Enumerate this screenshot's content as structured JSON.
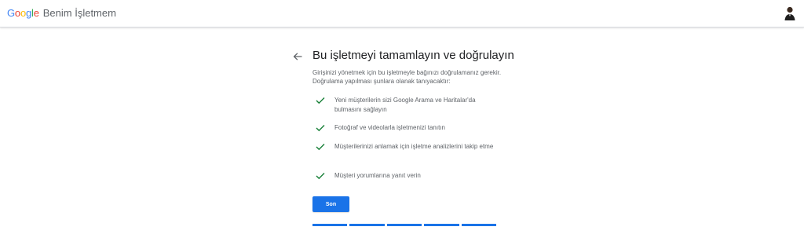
{
  "header": {
    "logo_letters": [
      "G",
      "o",
      "o",
      "g",
      "l",
      "e"
    ],
    "product_name": "Benim İşletmem",
    "avatar_icon": "user-avatar"
  },
  "main": {
    "back_icon": "arrow-left-icon",
    "title": "Bu işletmeyi tamamlayın ve doğrulayın",
    "intro": "Girişinizi yönetmek için bu işletmeyle bağınızı doğrulamanız gerekir. Doğrulama yapılması şunlara olanak tanıyacaktır:",
    "benefits": [
      "Yeni müşterilerin sizi Google Arama ve Haritalar'da bulmasını sağlayın",
      "Fotoğraf ve videolarla işletmenizi tanıtın",
      "Müşterilerinizi anlamak için işletme analizlerini takip etme",
      "Müşteri yorumlarına yanıt verin"
    ],
    "primary_button": "Son",
    "progress": {
      "steps_total": 5,
      "steps_completed": 5
    }
  },
  "colors": {
    "accent": "#1a73e8",
    "check": "#188038",
    "text_primary": "#202124",
    "text_secondary": "#5f6368"
  }
}
